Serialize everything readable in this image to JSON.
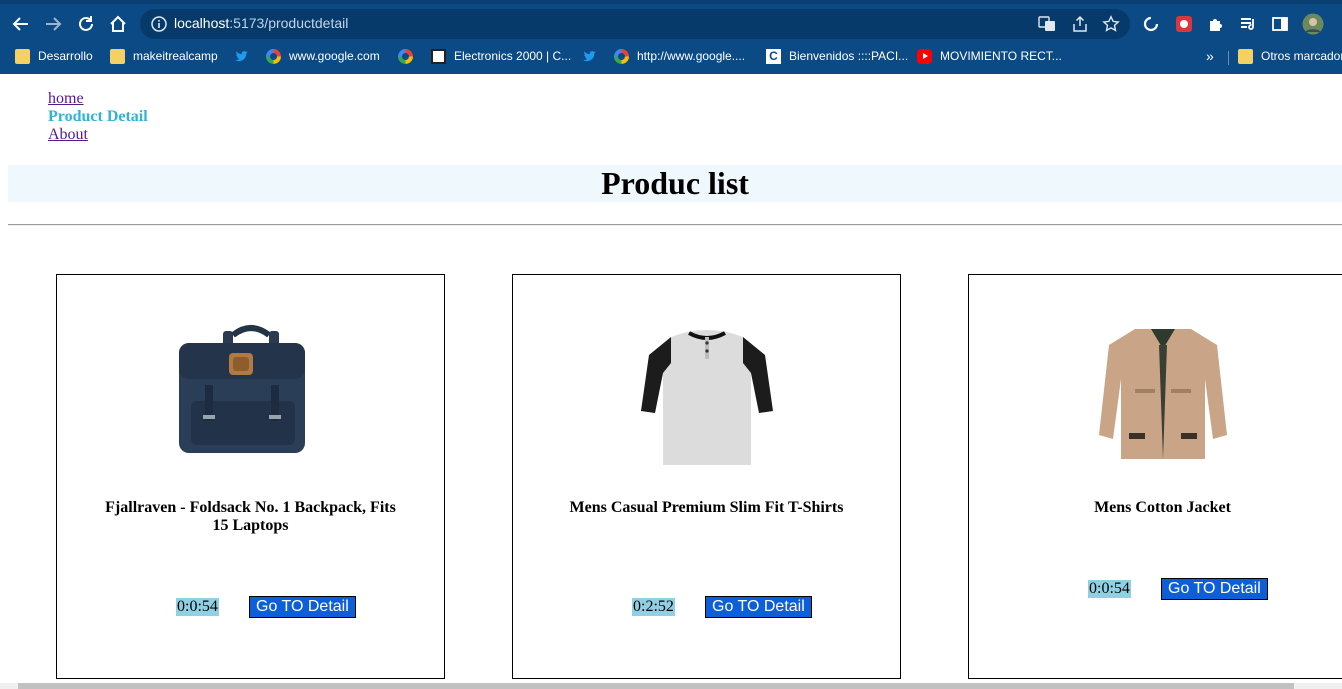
{
  "browser": {
    "url_host": "localhost",
    "url_path": ":5173/productdetail",
    "bookmarks": [
      {
        "label": "Desarrollo",
        "icon": "folder-icon"
      },
      {
        "label": "makeitrealcamp",
        "icon": "folder-icon"
      },
      {
        "label": "",
        "icon": "twitter-icon"
      },
      {
        "label": "www.google.com",
        "icon": "google-icon"
      },
      {
        "label": "",
        "icon": "google-icon"
      },
      {
        "label": "Electronics 2000 | C...",
        "icon": "grid-icon"
      },
      {
        "label": "",
        "icon": "twitter-icon"
      },
      {
        "label": "http://www.google....",
        "icon": "google-icon"
      },
      {
        "label": "Bienvenidos ::::PACI...",
        "icon": "c-icon"
      },
      {
        "label": "MOVIMIENTO RECT...",
        "icon": "youtube-icon"
      }
    ],
    "overflow": "»",
    "other_bookmarks": "Otros marcador"
  },
  "nav": {
    "home": "home",
    "product_detail": "Product Detail",
    "about": "About"
  },
  "page_title": "Produc list",
  "products": [
    {
      "name": "Fjallraven - Foldsack No. 1 Backpack, Fits 15 Laptops",
      "timer": "0:0:54",
      "button": "Go TO Detail",
      "image": "backpack"
    },
    {
      "name": "Mens Casual Premium Slim Fit T-Shirts",
      "timer": "0:2:52",
      "button": "Go TO Detail",
      "image": "tshirt"
    },
    {
      "name": "Mens Cotton Jacket",
      "timer": "0:0:54",
      "button": "Go TO Detail",
      "image": "jacket"
    }
  ],
  "colors": {
    "chrome": "#0b4a84",
    "active_link": "#2fb3d6",
    "title_band": "#eef8fd",
    "timer_bg": "#8fd1e3",
    "button_bg": "#0c5fd8"
  }
}
